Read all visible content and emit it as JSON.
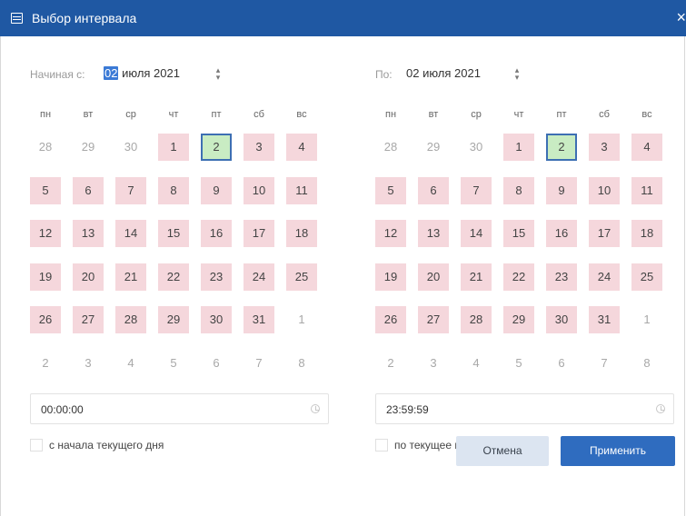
{
  "window": {
    "title": "Выбор интервала",
    "close_symbol": "×",
    "icons": {
      "title": "calendar-icon",
      "close": "close-icon",
      "time": "clock-icon"
    },
    "colors": {
      "titlebar": "#1f58a3",
      "range_day": "#f5d7dc",
      "today_fill": "#c9ecc3",
      "today_border": "#3d6fb3",
      "apply_button": "#2f6cbf",
      "cancel_button": "#dce5f1"
    }
  },
  "start": {
    "label": "Начиная с:",
    "day": "02",
    "month_year": "июля 2021",
    "time": "00:00:00",
    "checkbox_label": "с начала текущего дня",
    "checkbox_checked": false
  },
  "end": {
    "label": "По:",
    "date": "02 июля 2021",
    "time": "23:59:59",
    "checkbox_label": "по текущее время",
    "checkbox_checked": false
  },
  "calendar": {
    "weekdays": [
      "пн",
      "вт",
      "ср",
      "чт",
      "пт",
      "сб",
      "вс"
    ],
    "weeks": [
      [
        {
          "d": "28",
          "t": "other"
        },
        {
          "d": "29",
          "t": "other"
        },
        {
          "d": "30",
          "t": "other"
        },
        {
          "d": "1",
          "t": "in"
        },
        {
          "d": "2",
          "t": "today"
        },
        {
          "d": "3",
          "t": "in"
        },
        {
          "d": "4",
          "t": "in"
        }
      ],
      [
        {
          "d": "5",
          "t": "in"
        },
        {
          "d": "6",
          "t": "in"
        },
        {
          "d": "7",
          "t": "in"
        },
        {
          "d": "8",
          "t": "in"
        },
        {
          "d": "9",
          "t": "in"
        },
        {
          "d": "10",
          "t": "in"
        },
        {
          "d": "11",
          "t": "in"
        }
      ],
      [
        {
          "d": "12",
          "t": "in"
        },
        {
          "d": "13",
          "t": "in"
        },
        {
          "d": "14",
          "t": "in"
        },
        {
          "d": "15",
          "t": "in"
        },
        {
          "d": "16",
          "t": "in"
        },
        {
          "d": "17",
          "t": "in"
        },
        {
          "d": "18",
          "t": "in"
        }
      ],
      [
        {
          "d": "19",
          "t": "in"
        },
        {
          "d": "20",
          "t": "in"
        },
        {
          "d": "21",
          "t": "in"
        },
        {
          "d": "22",
          "t": "in"
        },
        {
          "d": "23",
          "t": "in"
        },
        {
          "d": "24",
          "t": "in"
        },
        {
          "d": "25",
          "t": "in"
        }
      ],
      [
        {
          "d": "26",
          "t": "in"
        },
        {
          "d": "27",
          "t": "in"
        },
        {
          "d": "28",
          "t": "in"
        },
        {
          "d": "29",
          "t": "in"
        },
        {
          "d": "30",
          "t": "in"
        },
        {
          "d": "31",
          "t": "in"
        },
        {
          "d": "1",
          "t": "other"
        }
      ],
      [
        {
          "d": "2",
          "t": "other"
        },
        {
          "d": "3",
          "t": "other"
        },
        {
          "d": "4",
          "t": "other"
        },
        {
          "d": "5",
          "t": "other"
        },
        {
          "d": "6",
          "t": "other"
        },
        {
          "d": "7",
          "t": "other"
        },
        {
          "d": "8",
          "t": "other"
        }
      ]
    ]
  },
  "buttons": {
    "cancel": "Отмена",
    "apply": "Применить"
  }
}
